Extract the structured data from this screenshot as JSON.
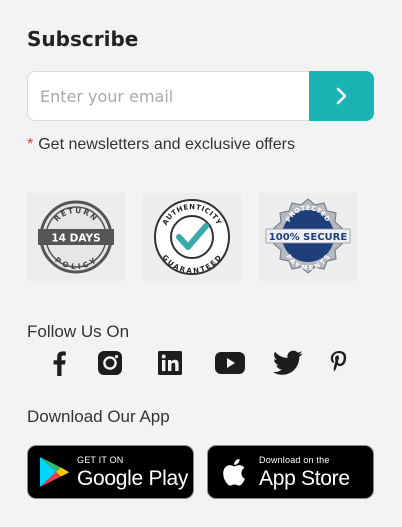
{
  "subscribe": {
    "title": "Subscribe",
    "email_placeholder": "Enter your email",
    "required_mark": "*",
    "note": "Get newsletters and exclusive offers",
    "accent_color": "#1ab3b3"
  },
  "badges": [
    {
      "name": "return-policy-badge",
      "top": "RETURN",
      "middle": "14 DAYS",
      "bottom": "POLICY"
    },
    {
      "name": "authenticity-badge",
      "top": "AUTHENTICITY",
      "bottom": "GUARANTEED"
    },
    {
      "name": "secure-payments-badge",
      "top": "PROTECTED",
      "middle": "100% SECURE",
      "bottom": "PAYMENTS"
    }
  ],
  "follow": {
    "label": "Follow Us On",
    "icons": [
      "facebook-icon",
      "instagram-icon",
      "linkedin-icon",
      "youtube-icon",
      "twitter-icon",
      "pinterest-icon"
    ]
  },
  "download": {
    "label": "Download Our App",
    "google_play": {
      "small": "GET IT ON",
      "big": "Google Play"
    },
    "app_store": {
      "small": "Download on the",
      "big": "App Store"
    }
  }
}
